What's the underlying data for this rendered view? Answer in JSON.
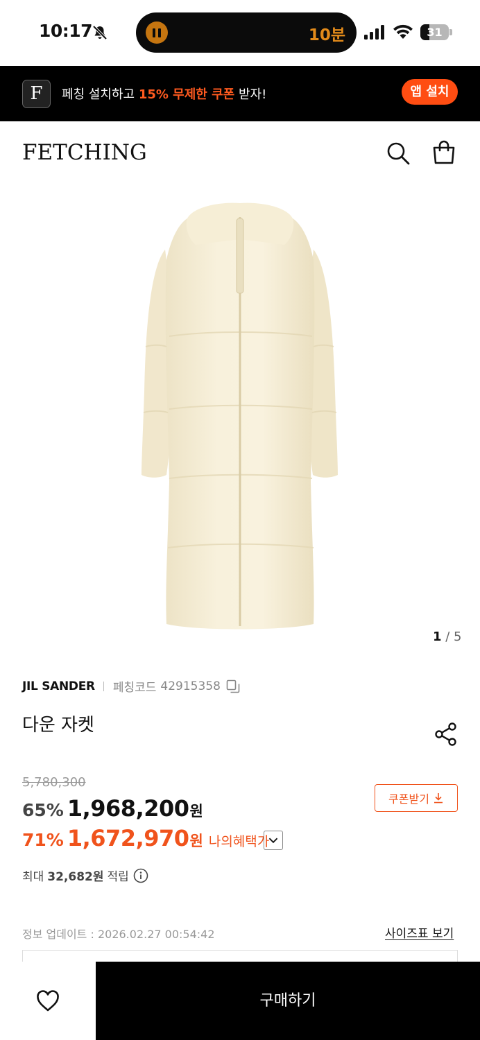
{
  "status_bar": {
    "time": "10:17",
    "island_timer": "10분",
    "battery": "31",
    "battery_level_percent": 31,
    "icons": [
      "bell-muted-icon",
      "pause-icon",
      "signal-icon",
      "wifi-icon",
      "battery-icon"
    ]
  },
  "promo": {
    "logo_letter": "F",
    "text_before": "페칭 설치하고 ",
    "text_highlight": "15% 무제한 쿠폰",
    "text_after": " 받자!",
    "button_label": "앱 설치",
    "highlight_color": "#ff5a1f"
  },
  "header": {
    "brand": "FETCHING",
    "icons": [
      "search-icon",
      "shopping-bag-icon"
    ]
  },
  "gallery": {
    "current": "1",
    "separator": " / ",
    "total": "5"
  },
  "product": {
    "brand": "JIL SANDER",
    "code_label": "페칭코드",
    "code": "42915358",
    "name": "다운 자켓",
    "original_price": "5,780,300",
    "discount_rate": "65%",
    "sale_price": "1,968,200",
    "currency": "원",
    "benefit_rate": "71%",
    "benefit_price": "1,672,970",
    "benefit_label": "나의혜택가",
    "accent_color": "#f0531c"
  },
  "coupon": {
    "label": "쿠폰받기"
  },
  "points": {
    "prefix": "최대",
    "value": "32,682원",
    "suffix": "적립"
  },
  "meta": {
    "update_text": "정보 업데이트 : 2026.02.27 00:54:42",
    "size_chart_link": "사이즈표 보기"
  },
  "bottom_bar": {
    "buy_label": "구매하기"
  }
}
